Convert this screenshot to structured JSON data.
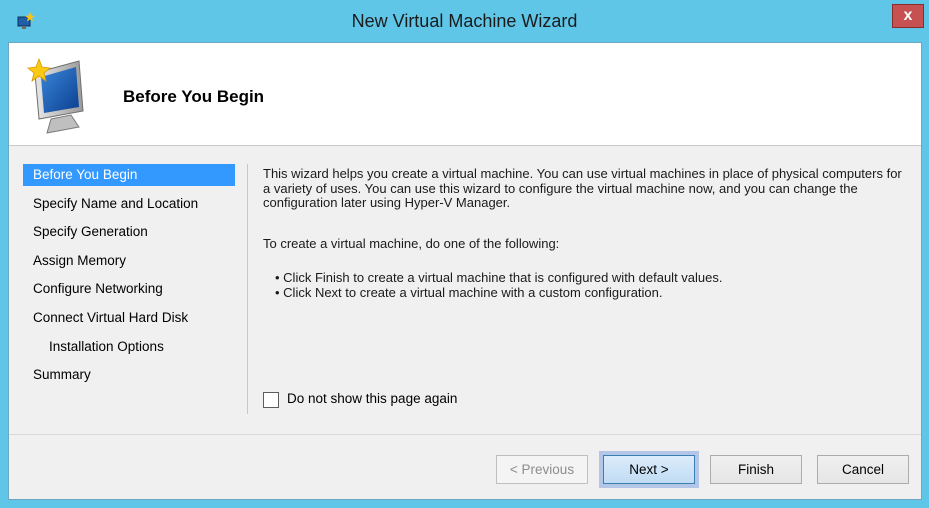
{
  "window": {
    "title": "New Virtual Machine Wizard",
    "close_glyph": "x"
  },
  "header": {
    "title": "Before You Begin",
    "icon": "new-vm-monitor-icon"
  },
  "nav": {
    "items": [
      {
        "label": "Before You Begin",
        "selected": true
      },
      {
        "label": "Specify Name and Location",
        "selected": false
      },
      {
        "label": "Specify Generation",
        "selected": false
      },
      {
        "label": "Assign Memory",
        "selected": false
      },
      {
        "label": "Configure Networking",
        "selected": false
      },
      {
        "label": "Connect Virtual Hard Disk",
        "selected": false
      },
      {
        "label": "Installation Options",
        "selected": false
      },
      {
        "label": "Summary",
        "selected": false
      }
    ]
  },
  "content": {
    "intro": "This wizard helps you create a virtual machine. You can use virtual machines in place of physical computers for a variety of uses. You can use this wizard to configure the virtual machine now, and you can change the configuration later using Hyper-V Manager.",
    "instruction": "To create a virtual machine, do one of the following:",
    "bullets": [
      "• Click Finish to create a virtual machine that is configured with default values.",
      "• Click Next to create a virtual machine with a custom configuration."
    ]
  },
  "checkbox": {
    "label": "Do not show this page again",
    "checked": false
  },
  "buttons": {
    "previous": "< Previous",
    "next": "Next >",
    "finish": "Finish",
    "cancel": "Cancel"
  },
  "colors": {
    "titlebar": "#5fc6e8",
    "selection": "#3399ff",
    "close": "#c75050"
  }
}
